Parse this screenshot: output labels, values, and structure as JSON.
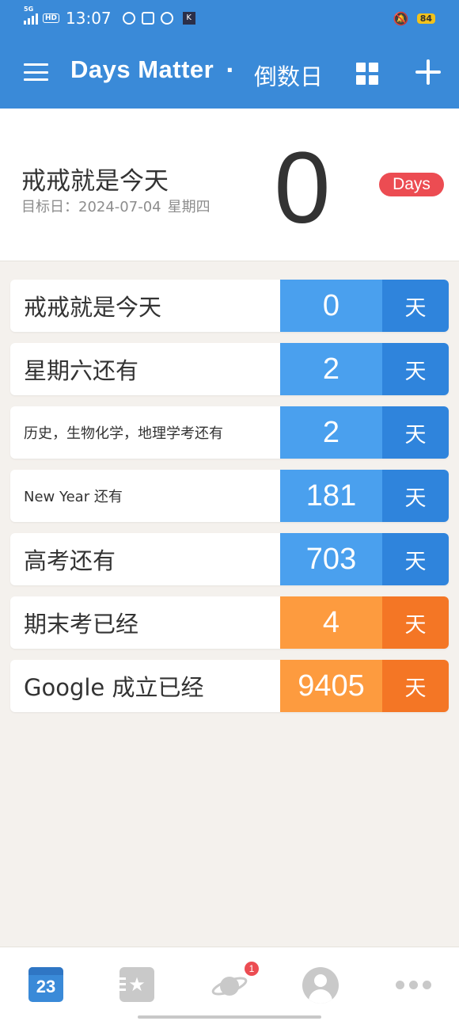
{
  "status_bar": {
    "network": "5G",
    "hd": "HD",
    "time": "13:07",
    "k_icon": "K",
    "battery": "84"
  },
  "app_bar": {
    "title": "Days Matter",
    "separator": "·",
    "subtitle": "倒数日",
    "icons": [
      "menu-icon",
      "grid-view-icon",
      "add-icon"
    ]
  },
  "hero": {
    "title": "戒戒就是今天",
    "target_date": "目标日：2024-07-04",
    "weekday": "星期四",
    "count": "0",
    "badge": "Days"
  },
  "events": [
    {
      "name": "戒戒就是今天",
      "days": "0",
      "unit": "天",
      "color": "blue"
    },
    {
      "name": "星期六还有",
      "days": "2",
      "unit": "天",
      "color": "blue"
    },
    {
      "name": "历史，生物化学，地理学考还有",
      "days": "2",
      "unit": "天",
      "color": "blue"
    },
    {
      "name": "New  Year  还有",
      "days": "181",
      "unit": "天",
      "color": "blue"
    },
    {
      "name": "高考还有",
      "days": "703",
      "unit": "天",
      "color": "blue"
    },
    {
      "name": "期末考已经",
      "days": "4",
      "unit": "天",
      "color": "orange"
    },
    {
      "name": "Google  成立已经",
      "days": "9405",
      "unit": "天",
      "color": "orange"
    }
  ],
  "bottom_nav": {
    "calendar_day": "23",
    "notification_count": "1",
    "items": [
      "calendar-icon",
      "star-icon",
      "planet-icon",
      "avatar-icon",
      "more-icon"
    ]
  },
  "colors": {
    "primary": "#3a8ad8",
    "count_blue": "#4aa0ee",
    "unit_blue": "#2f84dc",
    "count_orange": "#fd9b3f",
    "unit_orange": "#f47625",
    "badge_red": "#ec4c52"
  }
}
